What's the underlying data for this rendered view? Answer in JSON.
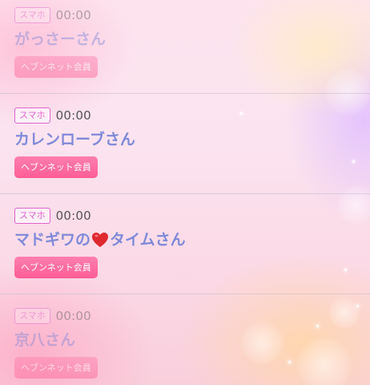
{
  "colors": {
    "badge_border": "#e263cf",
    "name_text": "#7f89d8",
    "member_tag_bg": "#ff6b9e",
    "heart": "#e0282f"
  },
  "members": [
    {
      "device": "スマホ",
      "time": "00:00",
      "name": "がっさーさん",
      "member_type": "ヘブンネット会員",
      "faded": true
    },
    {
      "device": "スマホ",
      "time": "00:00",
      "name": "カレンローブさん",
      "member_type": "ヘブンネット会員",
      "faded": false
    },
    {
      "device": "スマホ",
      "time": "00:00",
      "name_before_icon": "マドギワの",
      "name_icon": "red-heart-icon",
      "name_after_icon": "タイムさん",
      "member_type": "ヘブンネット会員",
      "faded": false
    },
    {
      "device": "スマホ",
      "time": "00:00",
      "name": "京八さん",
      "member_type": "ヘブンネット会員",
      "faded": true
    }
  ]
}
